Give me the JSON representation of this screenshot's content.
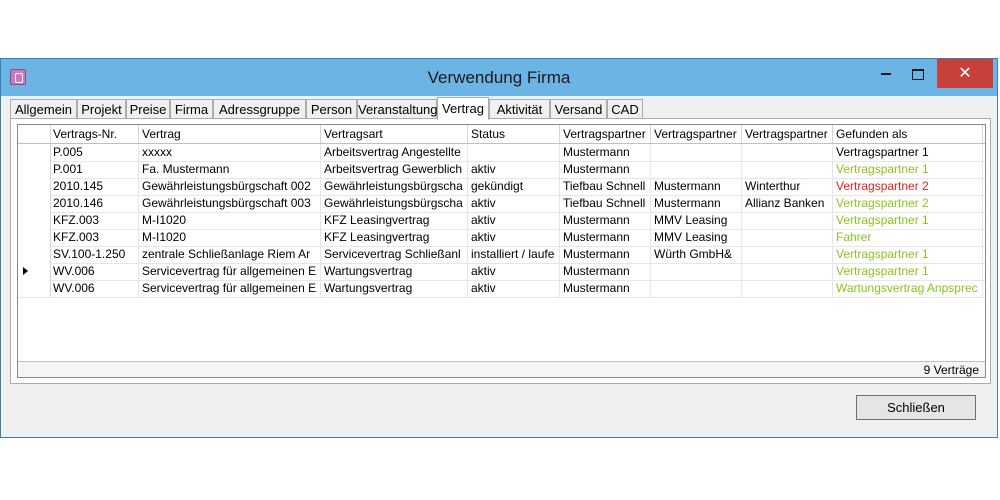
{
  "window": {
    "title": "Verwendung Firma",
    "close_symbol": "✕"
  },
  "tabs": [
    "Allgemein",
    "Projekt",
    "Preise",
    "Firma",
    "Adressgruppe",
    "Person",
    "Veranstaltung",
    "Vertrag",
    "Aktivität",
    "Versand",
    "CAD"
  ],
  "active_tab": "Vertrag",
  "table": {
    "columns": [
      "Vertrags-Nr.",
      "Vertrag",
      "Vertragsart",
      "Status",
      "Vertragspartner",
      "Vertragspartner",
      "Vertragspartner",
      "Gefunden als"
    ],
    "rows": [
      [
        "P.005",
        "xxxxx",
        "Arbeitsvertrag Angestellte",
        "",
        "Mustermann",
        "",
        "",
        "Vertragspartner 1"
      ],
      [
        "P.001",
        "Fa. Mustermann",
        "Arbeitsvertrag Gewerblich",
        "aktiv",
        "Mustermann",
        "",
        "",
        "Vertragspartner 1"
      ],
      [
        "2010.145",
        "Gewährleistungsbürgschaft 002",
        "Gewährleistungsbürgscha",
        "gekündigt",
        "Tiefbau Schnell",
        "Mustermann",
        "Winterthur",
        "Vertragspartner 2"
      ],
      [
        "2010.146",
        "Gewährleistungsbürgschaft 003",
        "Gewährleistungsbürgscha",
        "aktiv",
        "Tiefbau Schnell",
        "Mustermann",
        "Allianz Banken",
        "Vertragspartner 2"
      ],
      [
        "KFZ.003",
        "M-I1020",
        "KFZ Leasingvertrag",
        "aktiv",
        "Mustermann",
        "MMV Leasing",
        "",
        "Vertragspartner 1"
      ],
      [
        "KFZ.003",
        "M-I1020",
        "KFZ Leasingvertrag",
        "aktiv",
        "Mustermann",
        "MMV Leasing",
        "",
        "Fahrer"
      ],
      [
        "SV.100-1.250",
        "zentrale Schließanlage Riem Ar",
        "Servicevertrag Schließanl",
        "installiert / laufe",
        "Mustermann",
        "Würth GmbH&",
        "",
        "Vertragspartner 1"
      ],
      [
        "WV.006",
        "Servicevertrag für allgemeinen E",
        "Wartungsvertrag",
        "aktiv",
        "Mustermann",
        "",
        "",
        "Vertragspartner 1"
      ],
      [
        "WV.006",
        "Servicevertrag für allgemeinen E",
        "Wartungsvertrag",
        "aktiv",
        "Mustermann",
        "",
        "",
        "Wartungsvertrag Anpsprec"
      ]
    ],
    "found_colors": [
      "#000000",
      "#8dc21f",
      "#e0221c",
      "#8dc21f",
      "#8dc21f",
      "#8dc21f",
      "#8dc21f",
      "#8dc21f",
      "#8dc21f"
    ],
    "current_row": 7,
    "count_label": "9 Verträge"
  },
  "buttons": {
    "close": "Schließen"
  }
}
